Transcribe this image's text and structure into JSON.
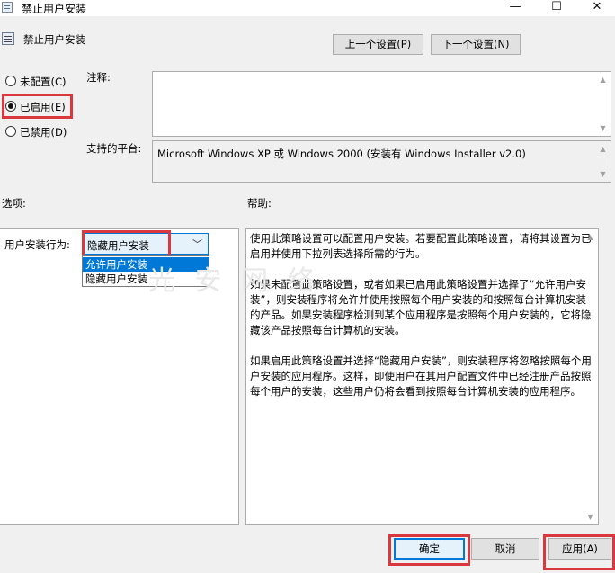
{
  "window": {
    "title": "禁止用户安装",
    "minimize_glyph": "—",
    "maximize_glyph": "☐",
    "close_glyph": "✕",
    "icon": "policy-icon"
  },
  "header": {
    "policy_name": "禁止用户安装",
    "prev_button": "上一个设置(P)",
    "next_button": "下一个设置(N)"
  },
  "state": {
    "options": [
      {
        "label": "未配置(C)",
        "selected": false
      },
      {
        "label": "已启用(E)",
        "selected": true
      },
      {
        "label": "已禁用(D)",
        "selected": false
      }
    ]
  },
  "comment": {
    "label": "注释:",
    "value": ""
  },
  "platform": {
    "label": "支持的平台:",
    "value": "Microsoft Windows XP 或 Windows 2000 (安装有 Windows Installer v2.0)"
  },
  "options_section": {
    "label": "选项:",
    "behavior_label": "用户安装行为:",
    "combo_value": "隐藏用户安装",
    "dropdown_items": [
      "允许用户安装",
      "隐藏用户安装"
    ],
    "highlighted_item": "允许用户安装"
  },
  "help_section": {
    "label": "帮助:",
    "paragraphs": [
      "使用此策略设置可以配置用户安装。若要配置此策略设置，请将其设置为已启用并使用下拉列表选择所需的行为。",
      "如果未配置此策略设置，或者如果已启用此策略设置并选择了“允许用户安装”，则安装程序将允许并使用按照每个用户安装的和按照每台计算机安装的产品。如果安装程序检测到某个应用程序是按照每个用户安装的，它将隐藏该产品按照每台计算机的安装。",
      "如果启用此策略设置并选择“隐藏用户安装”，则安装程序将忽略按照每个用户安装的应用程序。这样，即使用户在其用户配置文件中已经注册产品按照每个用户的安装，这些用户仍将会看到按照每台计算机安装的应用程序。"
    ]
  },
  "watermark": "光 安 网 络",
  "footer": {
    "ok_button": "确定",
    "cancel_button": "取消",
    "apply_button": "应用(A)"
  },
  "colors": {
    "highlight_red": "#d9393e",
    "accent_blue": "#0078d7"
  }
}
